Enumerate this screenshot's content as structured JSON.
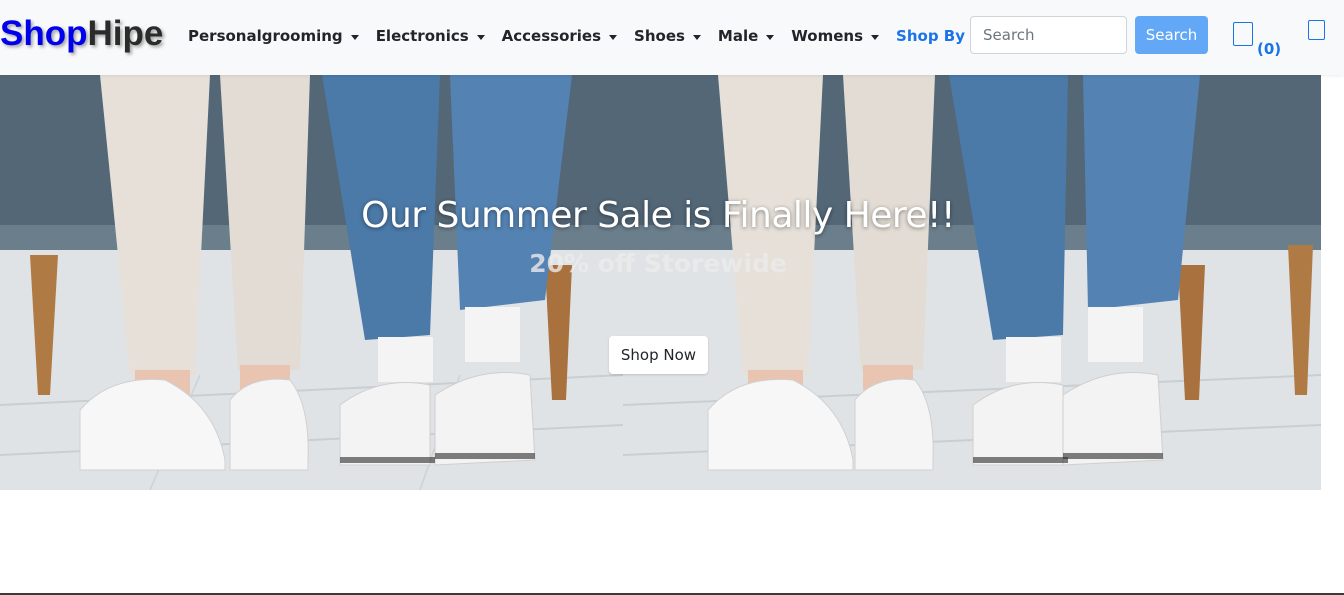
{
  "navbar": {
    "brand_part1": "Shop",
    "brand_part2": "Hipe",
    "items": [
      {
        "label": "Personalgrooming"
      },
      {
        "label": "Electronics"
      },
      {
        "label": "Accessories"
      },
      {
        "label": "Shoes"
      },
      {
        "label": "Male"
      },
      {
        "label": "Womens"
      },
      {
        "label": "Shop By Brand"
      }
    ],
    "search_placeholder": "Search",
    "search_button_label": "Search",
    "cart_count": "(0)",
    "icons": {
      "cart": "cart-icon",
      "user": "user-icon",
      "dropdown": "caret-down-icon"
    }
  },
  "hero": {
    "title": "Our Summer Sale is Finally Here!!",
    "subtitle": "20% off Storewide",
    "button_label": "Shop Now"
  },
  "colors": {
    "brand_primary": "#0000ee",
    "brand_secondary": "#2b2b2b",
    "accent_link": "#1a73e8",
    "search_button": "#62a8f7",
    "navbar_bg": "#f8f9fa"
  }
}
